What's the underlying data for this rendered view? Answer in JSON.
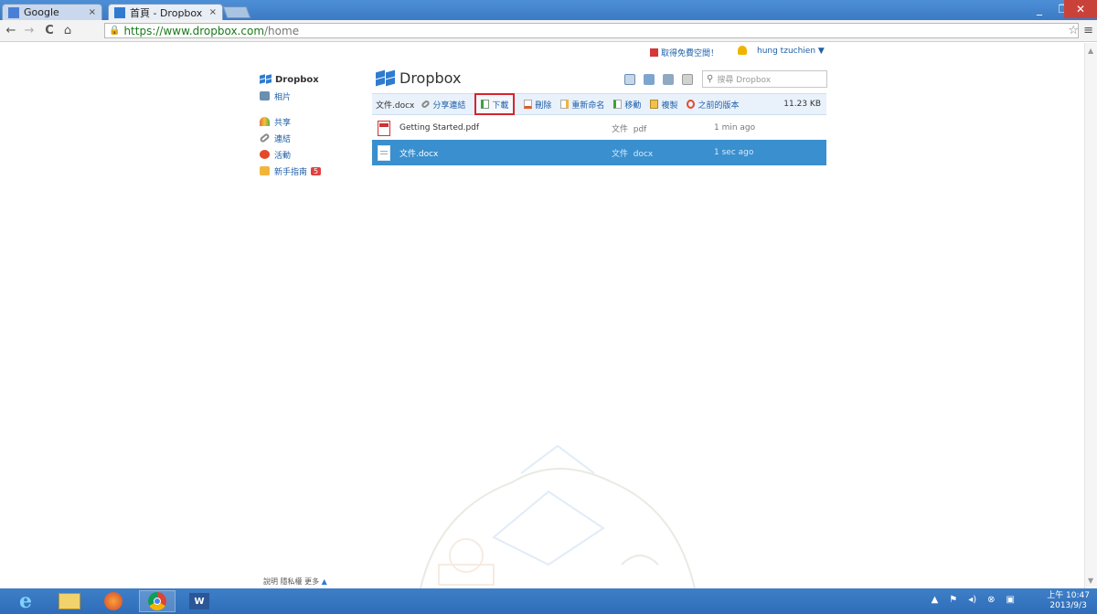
{
  "browser": {
    "tabs": [
      {
        "label": "Google",
        "active": false
      },
      {
        "label": "首頁 - Dropbox",
        "active": true
      }
    ],
    "close_glyph": "×",
    "url_secure": "https://www.dropbox.com",
    "url_path": "/home"
  },
  "header": {
    "promo": "取得免費空間！",
    "user": "hung tzuchien ▼"
  },
  "sidebar": {
    "brand": "Dropbox",
    "items": [
      {
        "label": "相片",
        "icon": "photos-icon",
        "color": "#6a8fb0"
      },
      {
        "label": "共享",
        "icon": "sharing-icon",
        "color": "#e7733b"
      },
      {
        "label": "連結",
        "icon": "link-icon",
        "color": "#8a8a8a"
      },
      {
        "label": "活動",
        "icon": "events-icon",
        "color": "#e24a2d"
      },
      {
        "label": "新手指南",
        "icon": "getting-started-icon",
        "color": "#f2b53a",
        "badge": "5"
      }
    ]
  },
  "main": {
    "title": "Dropbox",
    "search_placeholder": "搜尋 Dropbox",
    "actionbar": {
      "selected_file": "文件.docx",
      "share_link": "分享連結",
      "download": "下載",
      "delete": "刪除",
      "rename": "重新命名",
      "move": "移動",
      "copy": "複製",
      "previous_versions": "之前的版本",
      "size": "11.23 KB"
    },
    "files": [
      {
        "name": "Getting Started.pdf",
        "kind": "文件",
        "ext": "pdf",
        "modified": "1 min ago",
        "selected": false
      },
      {
        "name": "文件.docx",
        "kind": "文件",
        "ext": "docx",
        "modified": "1 sec ago",
        "selected": true
      }
    ]
  },
  "footer": {
    "links": "說明 隱私權 更多",
    "arrow": "▲"
  },
  "taskbar": {
    "clock_time": "上午 10:47",
    "clock_date": "2013/9/3"
  },
  "colors": {
    "accent": "#1f5fa8",
    "selected_row": "#3a8fce",
    "highlight_border": "#d6252b"
  }
}
